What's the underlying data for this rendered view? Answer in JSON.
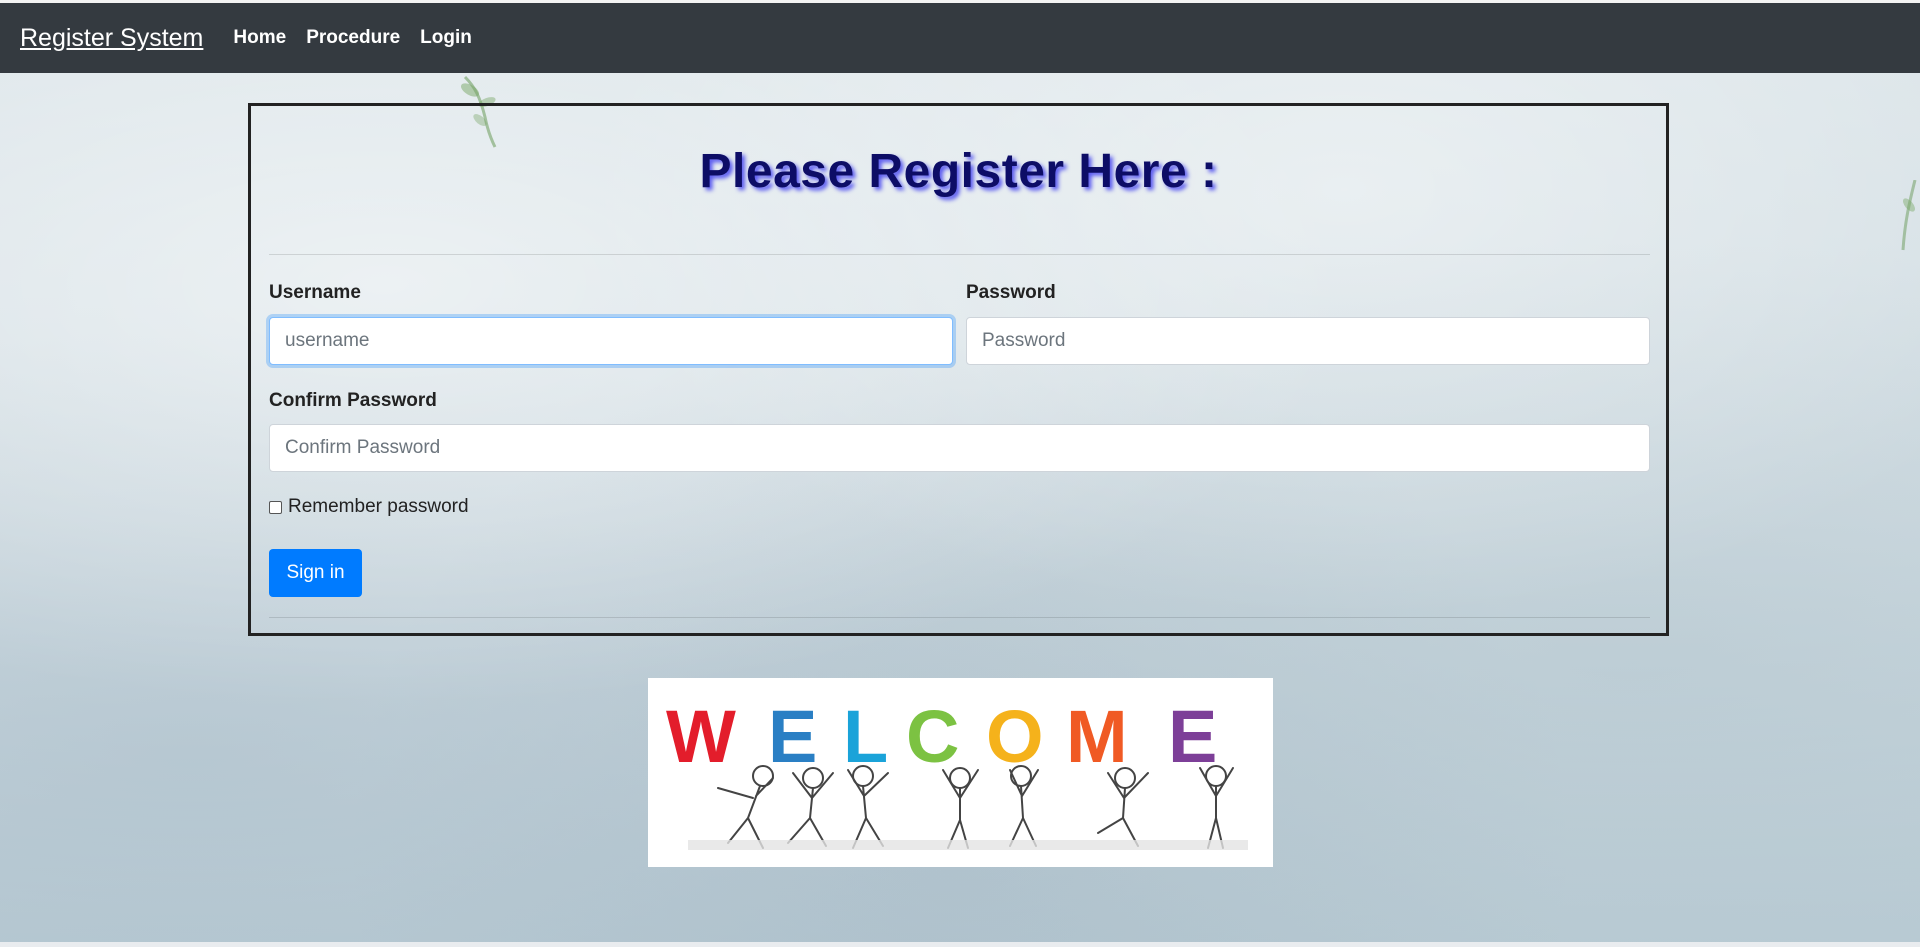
{
  "navbar": {
    "brand": "Register System",
    "links": [
      "Home",
      "Procedure",
      "Login"
    ]
  },
  "form": {
    "title": "Please Register Here :",
    "username": {
      "label": "Username",
      "placeholder": "username",
      "value": ""
    },
    "password": {
      "label": "Password",
      "placeholder": "Password",
      "value": ""
    },
    "confirm_password": {
      "label": "Confirm Password",
      "placeholder": "Confirm Password",
      "value": ""
    },
    "remember": {
      "label": "Remember password",
      "checked": false
    },
    "submit_label": "Sign in"
  },
  "welcome_image": {
    "letters": [
      "W",
      "E",
      "L",
      "C",
      "O",
      "M",
      "E"
    ],
    "letter_colors": [
      "#e31d2b",
      "#2a7fc4",
      "#1aa3d9",
      "#7cc242",
      "#f5b21b",
      "#f05a24",
      "#7d3f98"
    ]
  },
  "colors": {
    "navbar_bg": "#343a40",
    "primary": "#007bff",
    "title_color": "#0d0d66",
    "title_shadow": "#5a5af0"
  }
}
